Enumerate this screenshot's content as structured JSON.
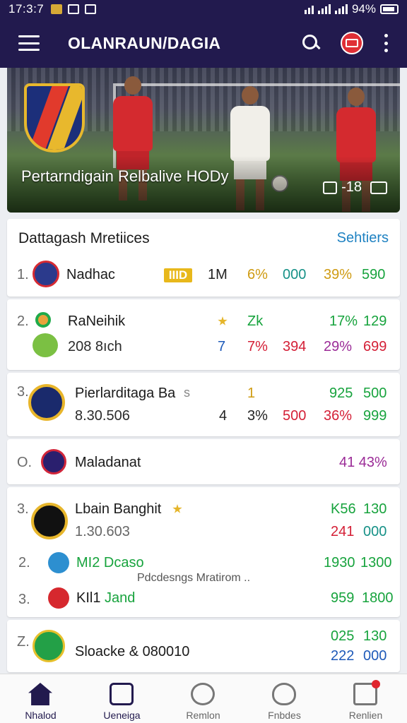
{
  "status_bar": {
    "time": "17:3:7",
    "battery": "94%"
  },
  "app_bar": {
    "title": "OLANRAUN/DAGIA",
    "icons": [
      "menu-icon",
      "search-icon",
      "badge-icon",
      "kebab-icon"
    ]
  },
  "hero": {
    "title": "Pertarndigain Relbalive HODy",
    "count": "-18"
  },
  "standings": {
    "title": "Dattagash Mretiices",
    "see_all": "Sehtiers",
    "rows": [
      {
        "rank": "1.",
        "name": "Nadhac",
        "tag": "IIID",
        "v1": "1M",
        "v2": "6%",
        "v3": "000",
        "v4": "39%",
        "v5": "590"
      }
    ]
  },
  "card2": {
    "rank": "2.",
    "name": "RaNeihik",
    "sub": "208 8ıch",
    "a1": "Zk",
    "a2": "17%",
    "a3": "129",
    "b0": "7",
    "b1": "7%",
    "b2": "394",
    "b3": "29%",
    "b4": "699"
  },
  "card3": {
    "rank": "3.",
    "name": "Pierlarditaga Ba",
    "name_tail": "s",
    "sub": "8.30.506",
    "a1": "1",
    "a2": "925",
    "a3": "500",
    "b0": "4",
    "b1": "3%",
    "b2": "500",
    "b3": "36%",
    "b4": "999"
  },
  "card4": {
    "rank": "O.",
    "name": "Maladanat",
    "value": "41 43%"
  },
  "card5": {
    "r1": {
      "rank": "3.",
      "name": "Lbain Banghit",
      "sub": "1.30.603",
      "a1": "K56",
      "a2": "130",
      "b1": "241",
      "b2": "000"
    },
    "r2": {
      "rank": "2.",
      "name": "MI2 Dcaso",
      "v1": "1930",
      "v2": "1300"
    },
    "hint": "Pdcdesngs Mratirom ..",
    "r3": {
      "rank": "3.",
      "name_a": "KIl1",
      "name_b": "Jand",
      "v1": "959",
      "v2": "1800"
    }
  },
  "card6": {
    "rank": "Z.",
    "name": "Sloacke & 080010",
    "a1": "025",
    "a2": "130",
    "b1": "222",
    "b2": "000"
  },
  "bottom_nav": [
    {
      "label": "Nhalod",
      "icon": "home-icon",
      "active": true
    },
    {
      "label": "Ueneiga",
      "icon": "standings-icon",
      "active": true
    },
    {
      "label": "Remlon",
      "icon": "ring-icon",
      "active": false
    },
    {
      "label": "Fnbdes",
      "icon": "cloud-icon",
      "active": false
    },
    {
      "label": "Renlien",
      "icon": "box-icon",
      "active": false
    }
  ],
  "colors": {
    "primary": "#221a4e",
    "link": "#1f82c2",
    "red": "#d41f36",
    "green": "#17a33d"
  }
}
